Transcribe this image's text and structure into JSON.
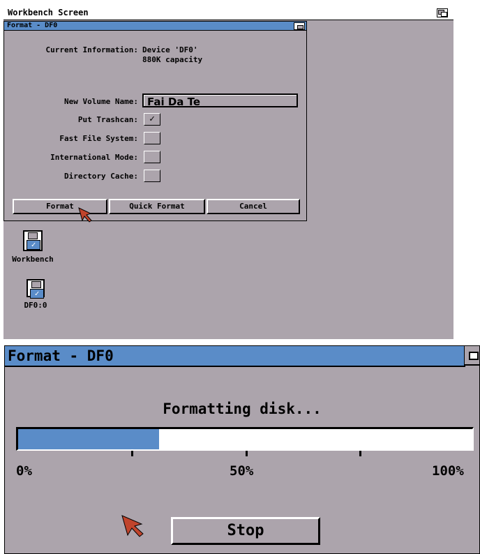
{
  "screen": {
    "title": "Workbench Screen"
  },
  "format_dialog": {
    "title": "Format - DF0",
    "current_info_label": "Current Information:",
    "device_line": "Device 'DF0'",
    "capacity_line": "880K capacity",
    "volume_label": "New Volume Name:",
    "volume_value": "Fai Da Te",
    "options": [
      {
        "label": "Put Trashcan:",
        "checked": true,
        "mark": "✓"
      },
      {
        "label": "Fast File System:",
        "checked": false,
        "mark": ""
      },
      {
        "label": "International Mode:",
        "checked": false,
        "mark": ""
      },
      {
        "label": "Directory Cache:",
        "checked": false,
        "mark": ""
      }
    ],
    "buttons": {
      "format": "Format",
      "quick_format": "Quick Format",
      "cancel": "Cancel"
    }
  },
  "desktop_icons": [
    {
      "label": "Workbench",
      "icon": "floppy-disk-icon"
    },
    {
      "label": "DF0:0",
      "icon": "floppy-disk-icon"
    }
  ],
  "progress_dialog": {
    "title": "Format - DF0",
    "status": "Formatting disk...",
    "progress_percent": 31,
    "scale": {
      "min": "0%",
      "mid": "50%",
      "max": "100%"
    },
    "stop_label": "Stop"
  },
  "colors": {
    "background": "#aca4ac",
    "titlebar": "#5a8cc8",
    "progress": "#5a8cc8",
    "pointer": "#c0442c"
  }
}
